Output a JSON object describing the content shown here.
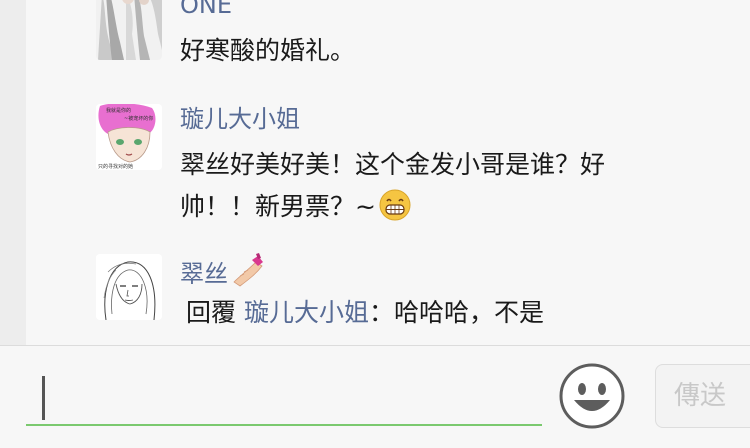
{
  "thread": {
    "comments": [
      {
        "author": "ONE",
        "text": "好寒酸的婚礼。",
        "avatar_icon": "avatar-figures-photo"
      },
      {
        "author": "璇儿大小姐",
        "text_line1": "翠丝好美好美！这个金发小哥是谁？好",
        "text_line2": "帅！！新男票？~",
        "trailing_emoji": "grinning-face-emoji",
        "avatar_icon": "avatar-pink-hair-cartoon",
        "avatar_caption_top": "我就是你的",
        "avatar_caption_mid": "~被宠坏的你",
        "avatar_caption_bottom": "只的寻找对的她"
      },
      {
        "author": "翠丝",
        "author_emoji": "nail-polish-emoji",
        "reply_prefix": "回覆",
        "reply_target": "璇儿大小姐",
        "reply_text": "：哈哈哈，不是",
        "avatar_icon": "avatar-sketch-girl"
      }
    ]
  },
  "input_bar": {
    "value": "",
    "placeholder": "",
    "emoji_button_icon": "smiley-face-icon",
    "send_label": "傳送"
  },
  "colors": {
    "author": "#576b95",
    "text": "#1a1a1a",
    "input_underline": "#7bc96f",
    "send_disabled_text": "#c8c8c8"
  }
}
